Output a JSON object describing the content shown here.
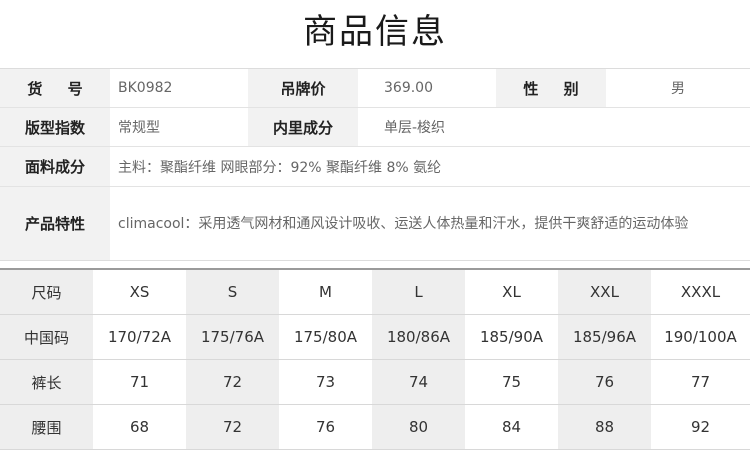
{
  "title": "商品信息",
  "info": {
    "row1": {
      "label1": "货 号",
      "value1": "BK0982",
      "label2": "吊牌价",
      "value2": "369.00",
      "label3": "性 别",
      "value3": "男"
    },
    "row2": {
      "label1": "版型指数",
      "value1": "常规型",
      "label2": "内里成分",
      "value2": "单层-梭织"
    },
    "row3": {
      "label": "面料成分",
      "value": "主料：聚酯纤维 网眼部分：92% 聚酯纤维 8% 氨纶"
    },
    "row4": {
      "label": "产品特性",
      "value": "climacool：采用透气网材和通风设计吸收、运送人体热量和汗水，提供干爽舒适的运动体验"
    }
  },
  "size_table": {
    "rows": [
      [
        "尺码",
        "XS",
        "S",
        "M",
        "L",
        "XL",
        "XXL",
        "XXXL"
      ],
      [
        "中国码",
        "170/72A",
        "175/76A",
        "175/80A",
        "180/86A",
        "185/90A",
        "185/96A",
        "190/100A"
      ],
      [
        "裤长",
        "71",
        "72",
        "73",
        "74",
        "75",
        "76",
        "77"
      ],
      [
        "腰围",
        "68",
        "72",
        "76",
        "80",
        "84",
        "88",
        "92"
      ]
    ]
  }
}
